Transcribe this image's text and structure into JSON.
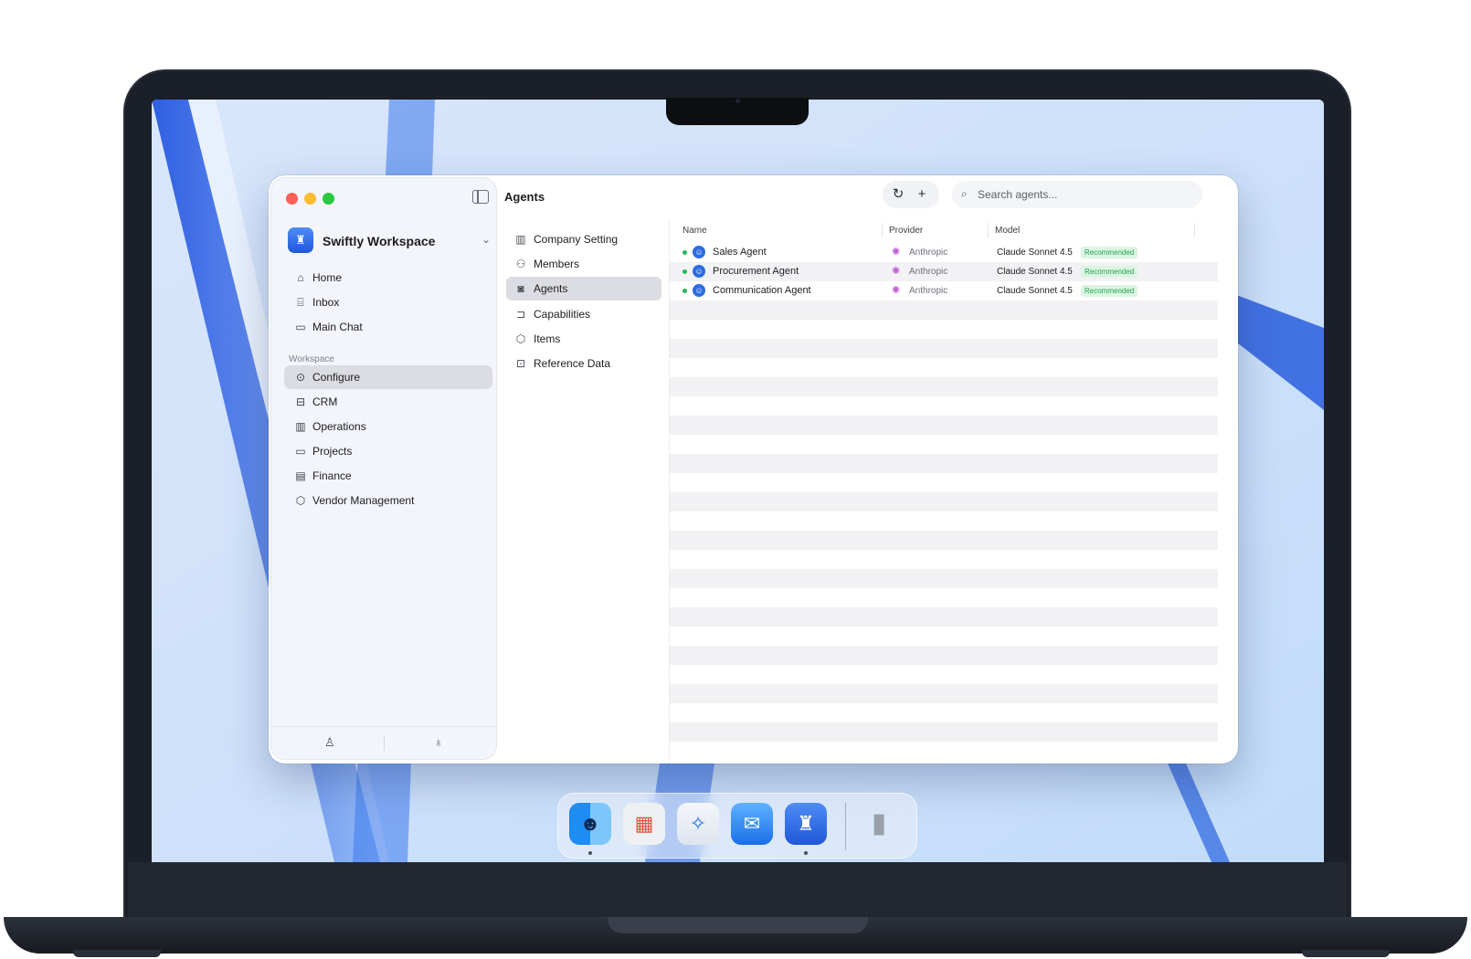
{
  "window": {
    "title": "Agents"
  },
  "workspace": {
    "name": "Swiftly Workspace"
  },
  "sidebar": {
    "items": [
      {
        "label": "Home",
        "icon": "home-icon"
      },
      {
        "label": "Inbox",
        "icon": "inbox-icon"
      },
      {
        "label": "Main Chat",
        "icon": "chat-icon"
      }
    ],
    "section_label": "Workspace",
    "workspace_items": [
      {
        "label": "Configure",
        "icon": "configure-icon",
        "active": true
      },
      {
        "label": "CRM",
        "icon": "briefcase-icon"
      },
      {
        "label": "Operations",
        "icon": "building-icon"
      },
      {
        "label": "Projects",
        "icon": "folder-icon"
      },
      {
        "label": "Finance",
        "icon": "finance-icon"
      },
      {
        "label": "Vendor Management",
        "icon": "box-icon"
      }
    ]
  },
  "toolbar": {
    "search_placeholder": "Search agents..."
  },
  "subnav": {
    "items": [
      {
        "label": "Company Setting",
        "icon": "building-icon"
      },
      {
        "label": "Members",
        "icon": "members-icon"
      },
      {
        "label": "Agents",
        "icon": "agent-icon",
        "active": true
      },
      {
        "label": "Capabilities",
        "icon": "capability-icon"
      },
      {
        "label": "Items",
        "icon": "box-icon"
      },
      {
        "label": "Reference Data",
        "icon": "folder-icon"
      }
    ]
  },
  "table": {
    "columns": [
      "Name",
      "Provider",
      "Model"
    ],
    "rows": [
      {
        "name": "Sales Agent",
        "provider": "Anthropic",
        "model": "Claude Sonnet 4.5",
        "badge": "Recommended",
        "status": "active"
      },
      {
        "name": "Procurement Agent",
        "provider": "Anthropic",
        "model": "Claude Sonnet 4.5",
        "badge": "Recommended",
        "status": "active"
      },
      {
        "name": "Communication Agent",
        "provider": "Anthropic",
        "model": "Claude Sonnet 4.5",
        "badge": "Recommended",
        "status": "active"
      }
    ]
  },
  "dock": {
    "apps": [
      "finder-icon",
      "launchpad-icon",
      "safari-icon",
      "mail-icon",
      "swiftly-app-icon",
      "trash-icon"
    ]
  },
  "colors": {
    "accent": "#2d6de0",
    "status_active": "#25b85a",
    "badge_bg": "#dbf5e2",
    "badge_text": "#23a34e",
    "provider_icon": "#c25bd6"
  }
}
